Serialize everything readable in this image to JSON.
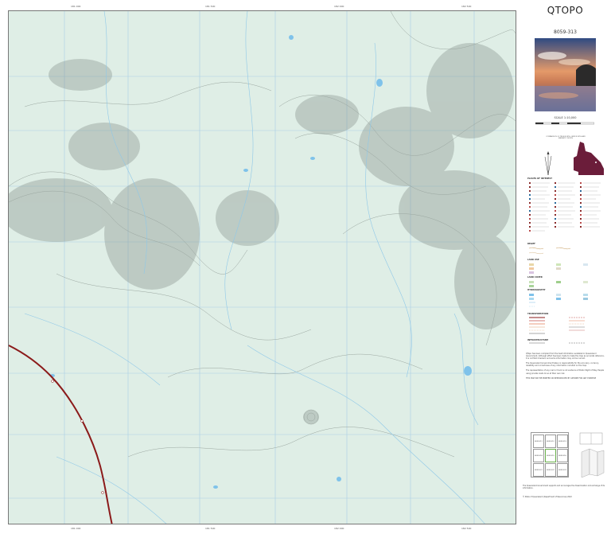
{
  "map": {
    "title": "QTOPO",
    "sheet_number": "8059-313",
    "scale": "SCALE 1:10,000",
    "north_note": "COMPARISON OF TRUE NORTH, GRID NORTH AND MAGNETIC NORTH",
    "colors": {
      "terrain": "#dfeee6",
      "contour": "#9aa6a0",
      "water_course": "#8fc8e8",
      "water_body": "#7fc2ea",
      "highway": "#8b1a1a",
      "grid": "#a9cfe6",
      "queensland_inset": "#6b1d3a"
    }
  },
  "legend": {
    "sections": [
      "PLACES OF INTEREST",
      "RELIEF",
      "LAND USE",
      "LAND COVER",
      "HYDROGRAPHY",
      "TRANSPORTATION",
      "INFRASTRUCTURE"
    ]
  },
  "disclaimer": {
    "p1": "QTopo has been compiled from the best information available to Queensland Government. Although effort has been made to make the map as accurate reference, it is not field checked, and some information may not be current.",
    "p2": "The Queensland Government takes no responsibility for the accuracy, currency, reliability and correctness of any information included on the map.",
    "p3": "The representation of any road or track is not evidence of Public Right of Way. People using private roads do so at their own risk.",
    "p4": "THIS MAP MAY BE PRINTED OR REPRODUCED BY ANYONE FOR ANY PURPOSE"
  },
  "index_sheets": [
    "8059-311",
    "8059-312",
    "8059-313",
    "8059-314",
    "8059-315",
    "8059-316",
    "8059-321",
    "8059-322",
    "8059-323"
  ],
  "footer": {
    "line1": "The Queensland Government supports and encourages the dissemination and exchange of its information.",
    "line2": "© State of Queensland (Department of Resources) 2022"
  }
}
